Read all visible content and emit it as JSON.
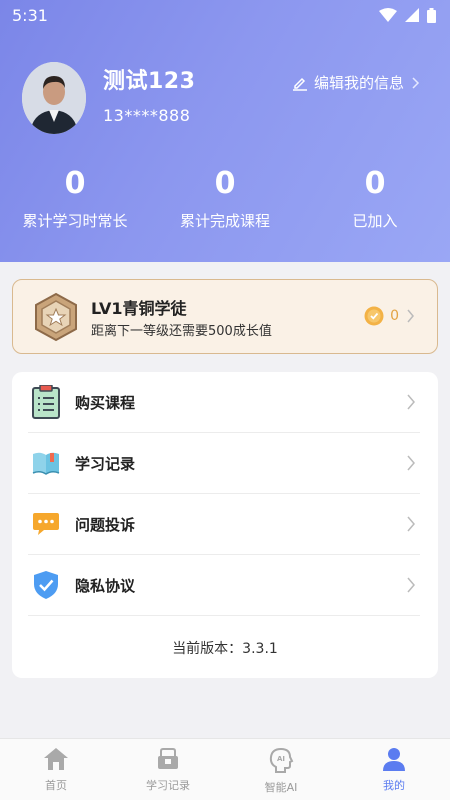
{
  "status": {
    "time": "5:31"
  },
  "user": {
    "name": "测试123",
    "phone": "13****888",
    "edit_label": "编辑我的信息"
  },
  "stats": [
    {
      "value": "0",
      "label": "累计学习时常长"
    },
    {
      "value": "0",
      "label": "累计完成课程"
    },
    {
      "value": "0",
      "label": "已加入"
    }
  ],
  "level": {
    "title": "LV1青铜学徒",
    "desc": "距离下一等级还需要500成长值",
    "coins": "0"
  },
  "menu": {
    "items": [
      {
        "label": "购买课程",
        "icon": "clipboard-list-icon"
      },
      {
        "label": "学习记录",
        "icon": "open-book-icon"
      },
      {
        "label": "问题投诉",
        "icon": "chat-bubble-icon"
      },
      {
        "label": "隐私协议",
        "icon": "shield-check-icon"
      }
    ],
    "version": "当前版本：3.3.1"
  },
  "tabs": [
    {
      "label": "首页",
      "icon": "home-icon"
    },
    {
      "label": "学习记录",
      "icon": "study-record-icon"
    },
    {
      "label": "智能AI",
      "icon": "ai-head-icon"
    },
    {
      "label": "我的",
      "icon": "user-icon",
      "active": true
    }
  ],
  "colors": {
    "hero_start": "#7b86e8",
    "hero_end": "#9aa7f5",
    "accent": "#5b7cf0",
    "level_bg": "#faf1e6"
  }
}
